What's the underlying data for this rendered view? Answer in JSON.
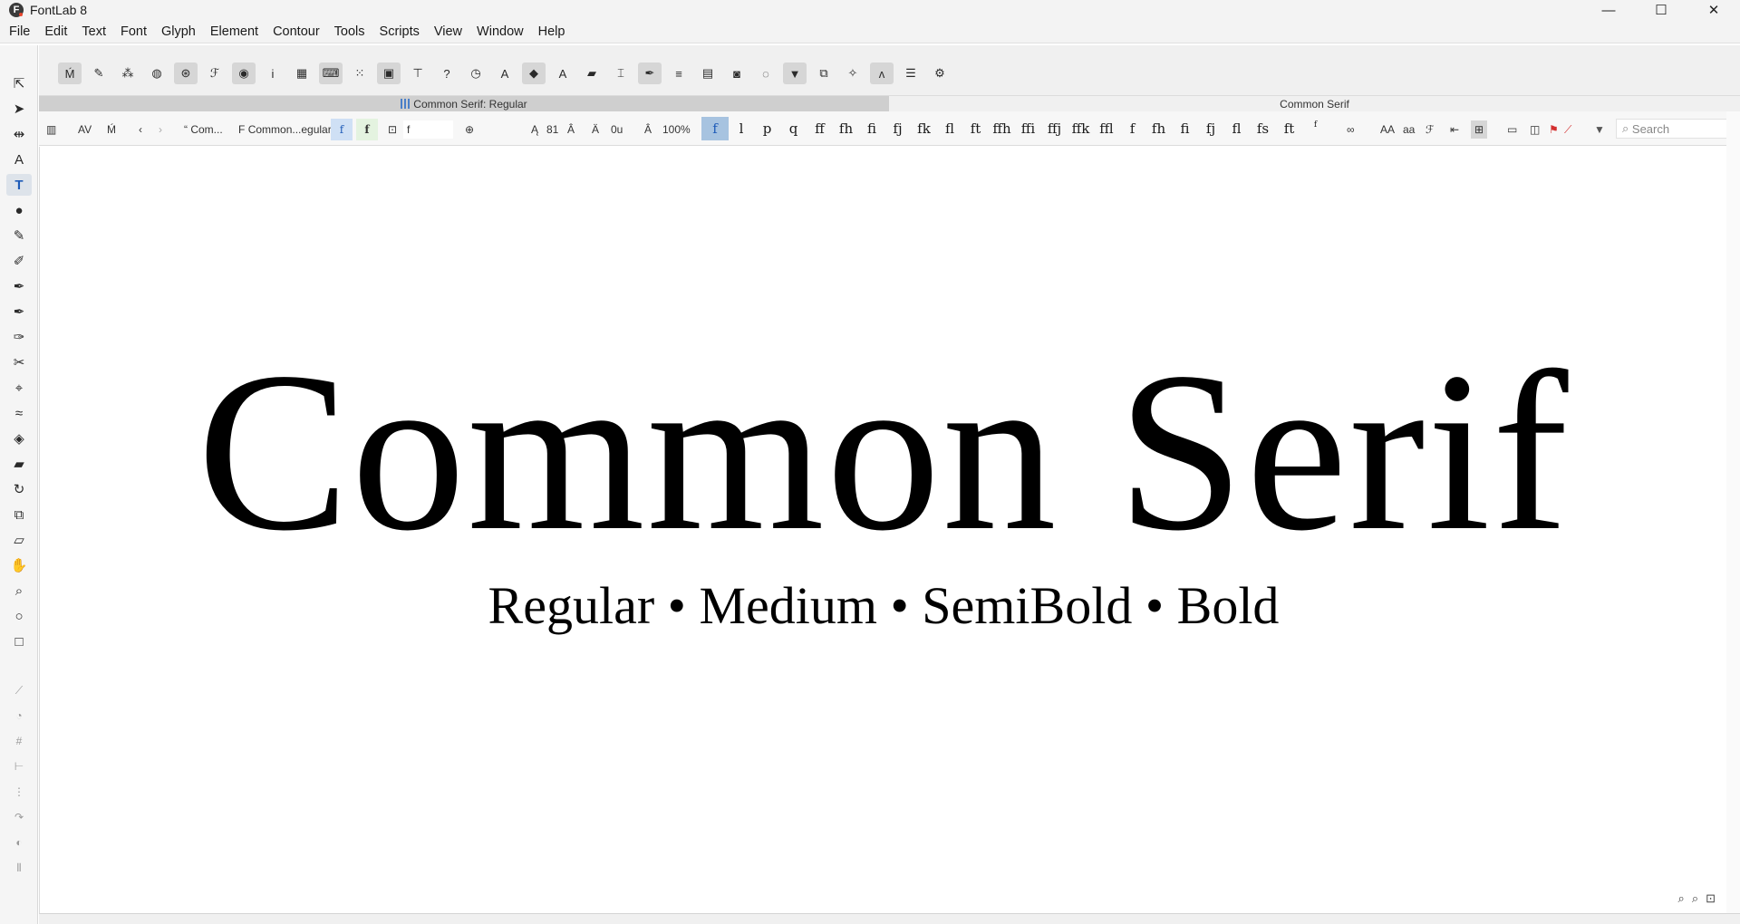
{
  "app": {
    "logo_letter": "F",
    "title": "FontLab 8"
  },
  "window_controls": {
    "minimize": "—",
    "maximize": "☐",
    "close": "✕"
  },
  "menu": [
    {
      "label": "File"
    },
    {
      "label": "Edit"
    },
    {
      "label": "Text"
    },
    {
      "label": "Font"
    },
    {
      "label": "Glyph"
    },
    {
      "label": "Element"
    },
    {
      "label": "Contour"
    },
    {
      "label": "Tools"
    },
    {
      "label": "Scripts"
    },
    {
      "label": "View"
    },
    {
      "label": "Window"
    },
    {
      "label": "Help"
    }
  ],
  "tabs": {
    "active": "Common Serif: Regular",
    "inactive": "Common Serif"
  },
  "text_toolbar": {
    "text_name": "Com...",
    "font_name": "Common...egular",
    "glyph_f_regular": "f",
    "glyph_f_bold": "f",
    "glyph_field": "f",
    "size_value": "81",
    "tracking_value": "0u",
    "zoom": "100%",
    "glyphs": [
      "f",
      "l",
      "p",
      "q",
      "ff",
      "fh",
      "fi",
      "fj",
      "fk",
      "fl",
      "ft",
      "ffh",
      "ffi",
      "ffj",
      "ffk",
      "ffl",
      "f",
      "fh",
      "fi",
      "fj",
      "fl",
      "fs",
      "ft",
      "f"
    ],
    "case_upper": "AA",
    "case_lower": "aa",
    "search_placeholder": "Search"
  },
  "canvas": {
    "headline": "Common Serif",
    "subline": "Regular • Medium • SemiBold • Bold"
  },
  "colors": {
    "accent": "#1e5bb8",
    "selection": "#a7c3e0",
    "flag": "#d32f2f"
  }
}
